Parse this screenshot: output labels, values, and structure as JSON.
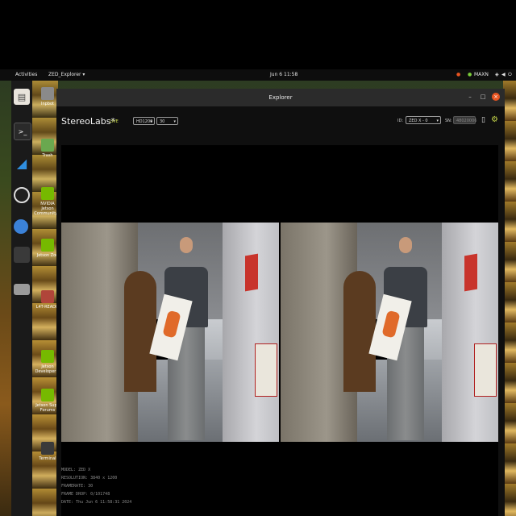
{
  "topbar": {
    "activities": "Activities",
    "app_menu": "ZED_Explorer ▾",
    "clock": "Jun 6 11:58",
    "power_mode": "MAXN",
    "tray_icons": [
      "nvidia-icon",
      "network-icon",
      "volume-icon",
      "power-icon"
    ]
  },
  "dock": {
    "items": [
      "files-icon",
      "terminal-icon",
      "vscode-icon",
      "obs-icon",
      "chromium-icon",
      "app-icon",
      "disk-icon"
    ]
  },
  "desktop": {
    "icons": [
      {
        "label": "Inpbot",
        "icon": "folder-icon"
      },
      {
        "label": "Trash",
        "icon": "trash-icon"
      },
      {
        "label": "NVIDIA Jetson Community P",
        "icon": "nvidia-icon"
      },
      {
        "label": "Jetson Zoo",
        "icon": "nvidia-icon"
      },
      {
        "label": "L4T-READM",
        "icon": "folder-icon"
      },
      {
        "label": "Jetson Developer Z",
        "icon": "nvidia-icon"
      },
      {
        "label": "Jetson Supp Forums",
        "icon": "nvidia-icon"
      },
      {
        "label": "Terminal",
        "icon": "terminal-icon"
      }
    ]
  },
  "window": {
    "title": "Explorer",
    "minimize": "–",
    "maximize": "□",
    "close": "×"
  },
  "toolbar": {
    "brand": "StereoLabs*",
    "live": "LIVE",
    "resolution": "HD1200",
    "fps": "30",
    "id_label": "ID:",
    "id_value": "ZED X - 0",
    "sn_label": "SN:",
    "sn_value": "48020006"
  },
  "info": {
    "model": "MODEL: ZED X",
    "resolution": "RESOLUTION: 3840 x 1200",
    "framerate": "FRAMERATE: 30",
    "frame_drop": "FRAME DROP: 0/101748",
    "date": "DATE: Thu Jun 6 11:58:31 2024"
  },
  "colors": {
    "accent": "#e95420",
    "live": "#c8d84a",
    "window_bg": "#0f0f0f"
  }
}
